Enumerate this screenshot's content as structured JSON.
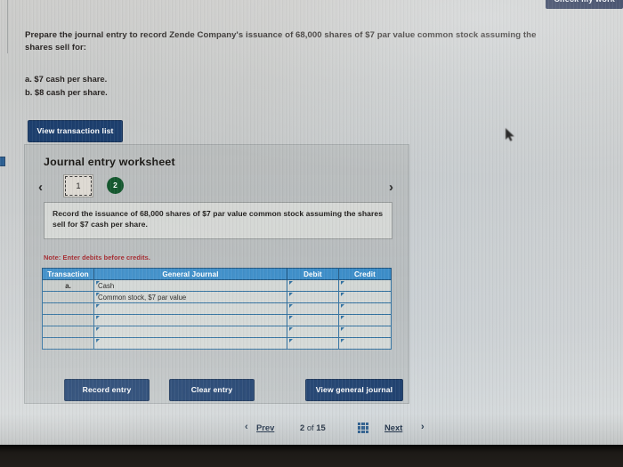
{
  "header": {
    "check_my_work_label": "Check my work"
  },
  "question": {
    "prompt": "Prepare the journal entry to record Zende Company's issuance of 68,000 shares of $7 par value common stock assuming the shares sell for:",
    "options": [
      "a. $7 cash per share.",
      "b. $8 cash per share."
    ],
    "view_transaction_list_label": "View transaction list"
  },
  "worksheet": {
    "title": "Journal entry worksheet",
    "prev_chevron": "‹",
    "next_chevron": "›",
    "tabs": [
      {
        "label": "1",
        "selected": true
      },
      {
        "label": "2",
        "selected": false
      }
    ],
    "instruction": "Record the issuance of 68,000 shares of $7 par value common stock assuming the shares sell for $7 cash per share.",
    "note": "Note: Enter debits before credits.",
    "table": {
      "columns": [
        "Transaction",
        "General Journal",
        "Debit",
        "Credit"
      ],
      "rows": [
        {
          "transaction": "a.",
          "general_journal": "Cash",
          "debit": "",
          "credit": ""
        },
        {
          "transaction": "",
          "general_journal": "Common stock, $7 par value",
          "debit": "",
          "credit": ""
        },
        {
          "transaction": "",
          "general_journal": "",
          "debit": "",
          "credit": ""
        },
        {
          "transaction": "",
          "general_journal": "",
          "debit": "",
          "credit": ""
        },
        {
          "transaction": "",
          "general_journal": "",
          "debit": "",
          "credit": ""
        },
        {
          "transaction": "",
          "general_journal": "",
          "debit": "",
          "credit": ""
        }
      ]
    },
    "actions": {
      "record_entry_label": "Record entry",
      "clear_entry_label": "Clear entry",
      "view_general_journal_label": "View general journal"
    }
  },
  "footer": {
    "prev_chevron": "‹",
    "prev_label": "Prev",
    "current_page": "2",
    "of_label": " of ",
    "total_pages": "15",
    "grid_icon_name": "grid-icon",
    "next_label": "Next",
    "next_chevron": "›"
  },
  "colors": {
    "button_navy": "#1d3f6e",
    "table_header_blue": "#3d8ec9",
    "note_red": "#a3242a",
    "badge_green": "#15582f"
  }
}
